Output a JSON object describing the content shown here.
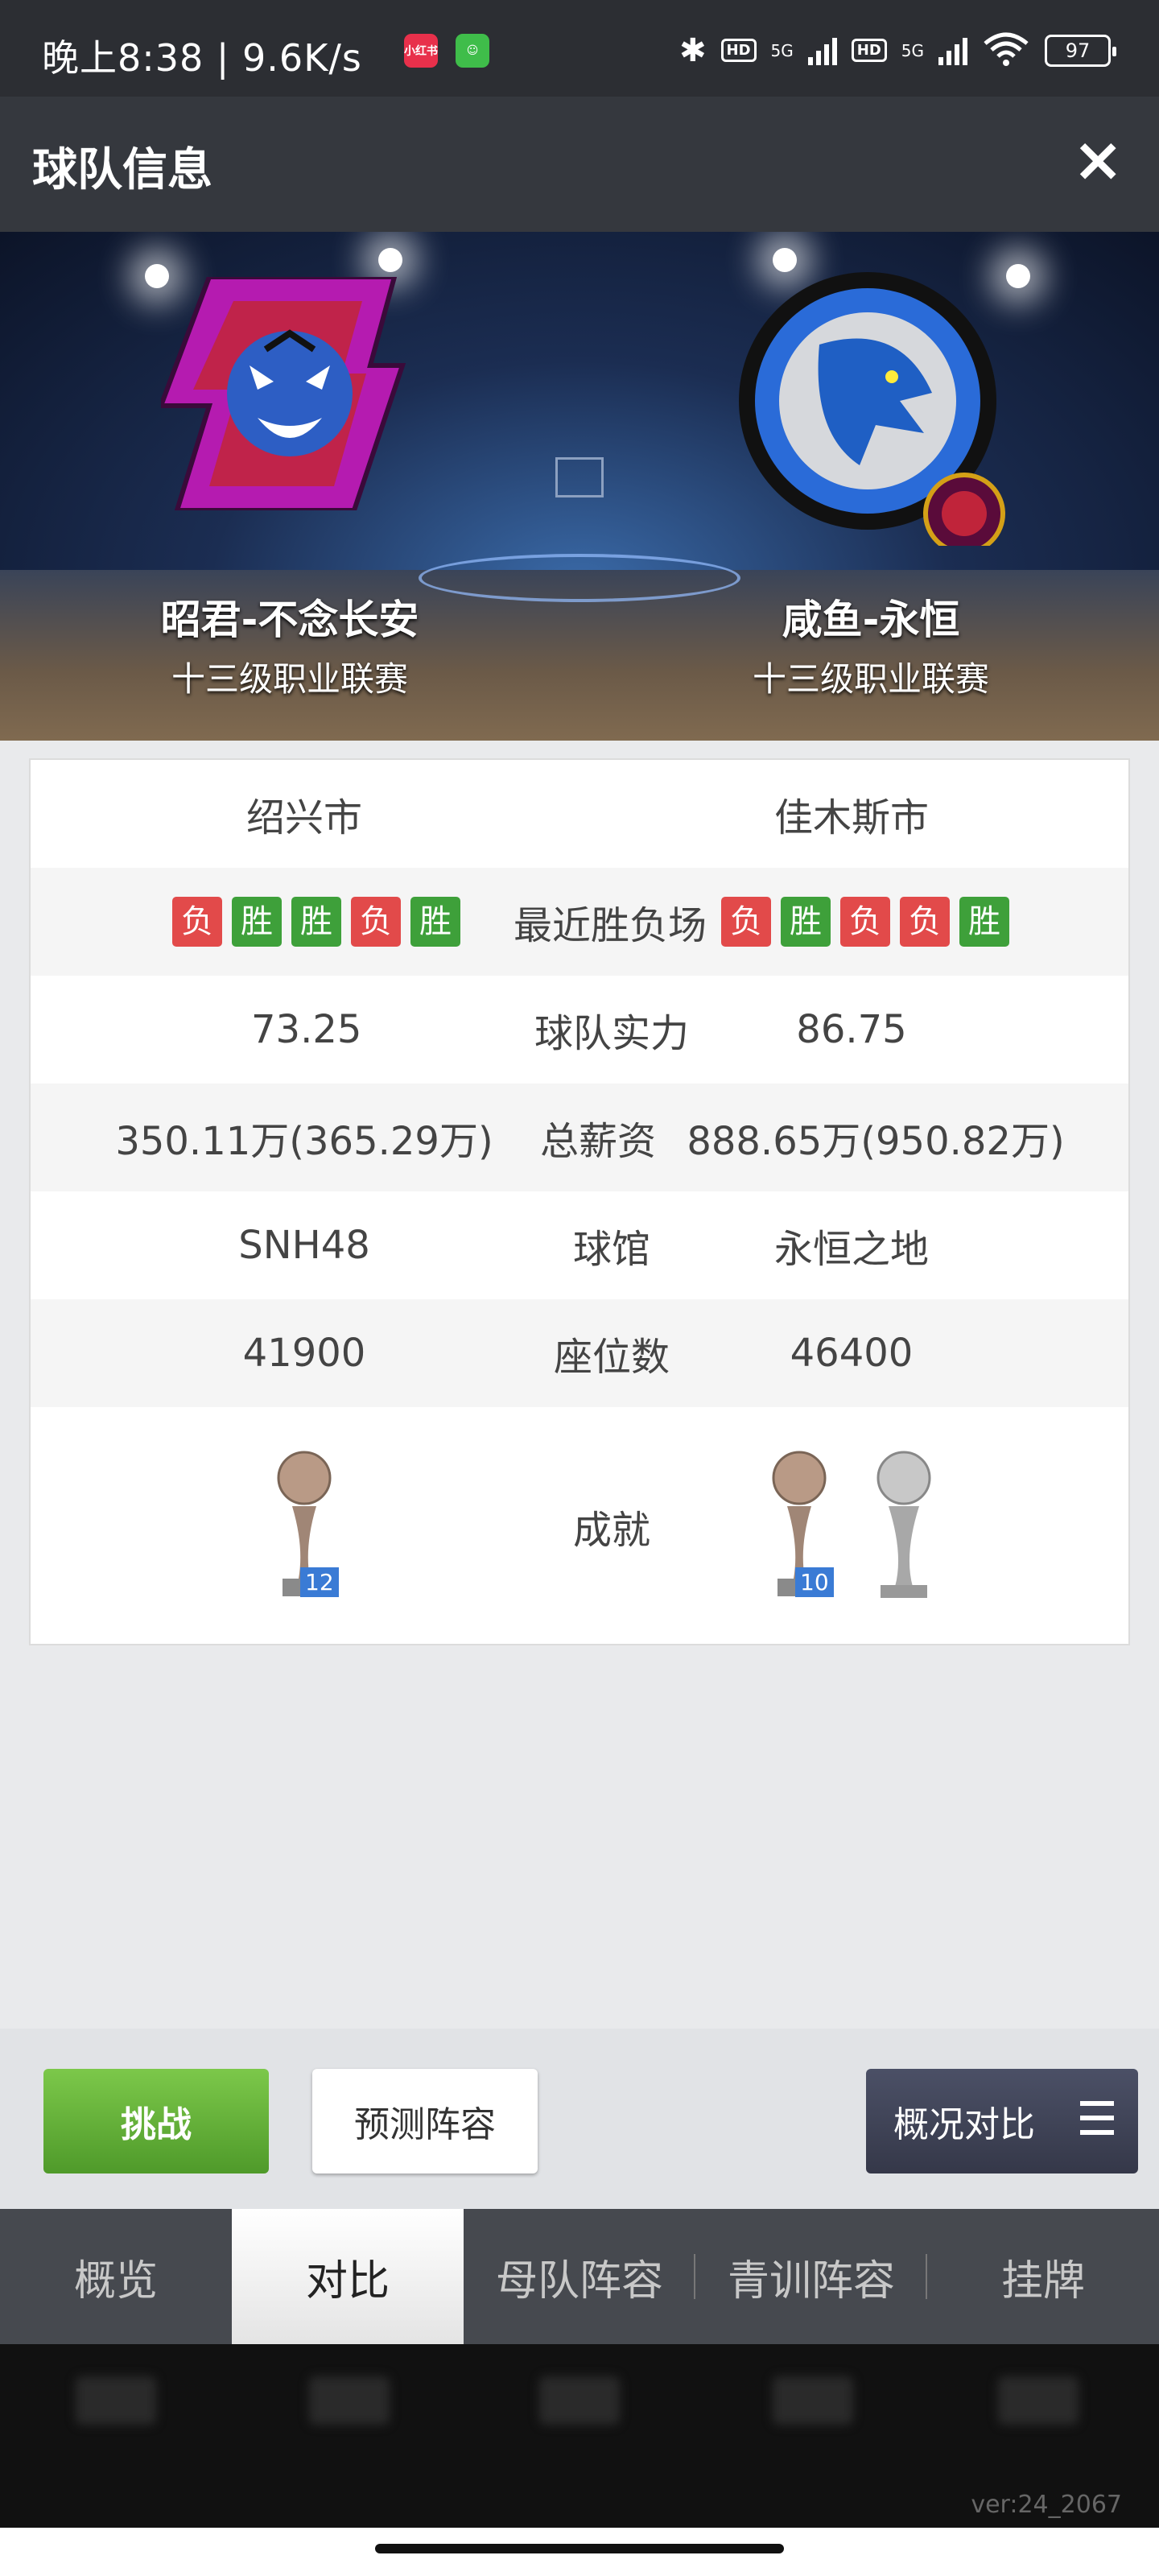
{
  "status_bar": {
    "time": "晚上8:38 | 9.6K/s",
    "app_icon_1": "小红书",
    "app_icon_1_color": "#e8304b",
    "app_icon_2_color": "#3fbd4a",
    "net1": "5G",
    "net2": "5G",
    "hd": "HD",
    "battery": "97"
  },
  "header": {
    "title": "球队信息",
    "close_icon": "×"
  },
  "hero": {
    "home": {
      "name": "昭君-不念长安",
      "league": "十三级职业联赛"
    },
    "away": {
      "name": "咸鱼-永恒",
      "league": "十三级职业联赛"
    }
  },
  "compare": {
    "city": {
      "home": "绍兴市",
      "away": "佳木斯市"
    },
    "recent": {
      "label": "最近胜负场",
      "home": [
        "负",
        "胜",
        "胜",
        "负",
        "胜"
      ],
      "away": [
        "负",
        "胜",
        "负",
        "负",
        "胜"
      ]
    },
    "strength": {
      "label": "球队实力",
      "home": "73.25",
      "away": "86.75"
    },
    "salary": {
      "label": "总薪资",
      "home": "350.11万(365.29万)",
      "away": "888.65万(950.82万)"
    },
    "arena": {
      "label": "球馆",
      "home": "SNH48",
      "away": "永恒之地"
    },
    "seats": {
      "label": "座位数",
      "home": "41900",
      "away": "46400"
    },
    "achievement": {
      "label": "成就",
      "home_count": "12",
      "away_count": "10"
    }
  },
  "actions": {
    "challenge": "挑战",
    "predict": "预测阵容",
    "compare": "概况对比"
  },
  "tabs": [
    "概览",
    "对比",
    "母队阵容",
    "青训阵容",
    "挂牌"
  ],
  "version": "ver:24_2067",
  "colors": {
    "win": "#3ea03a",
    "lose": "#e24a4a",
    "accent_green": "#5fae33"
  }
}
